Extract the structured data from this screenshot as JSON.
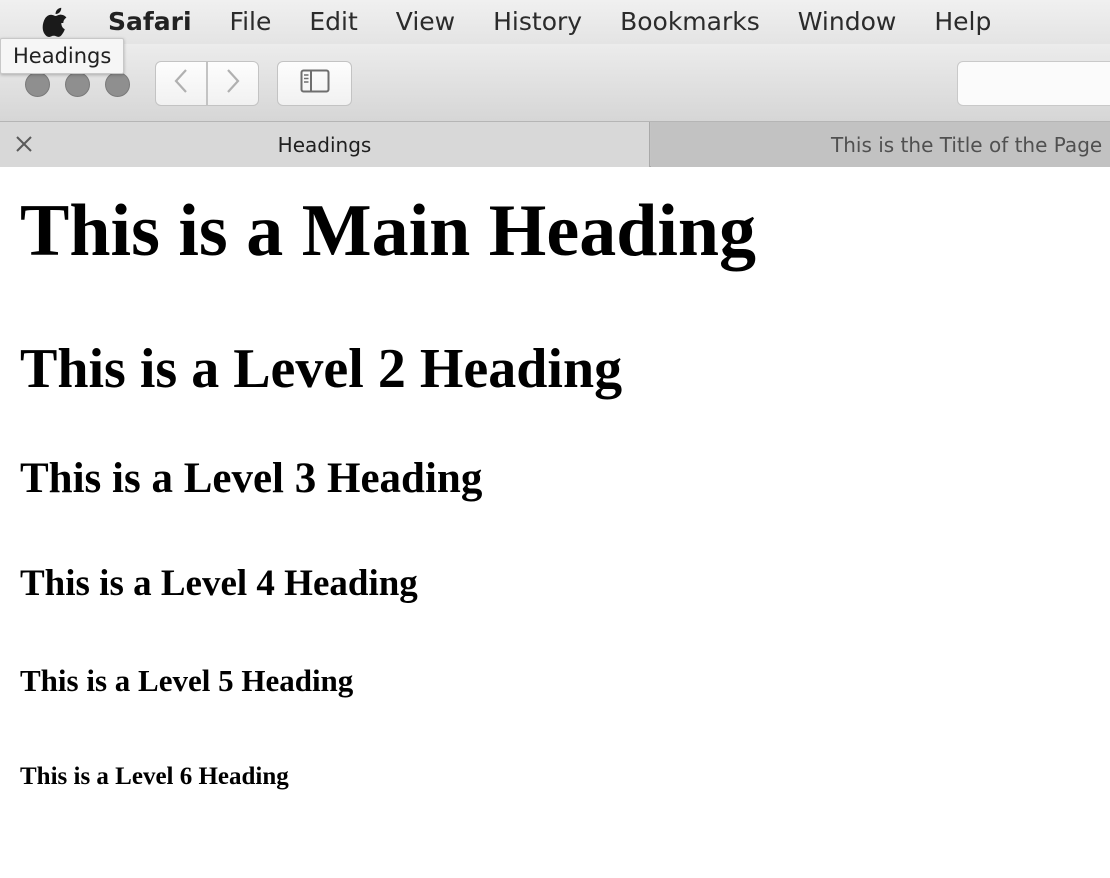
{
  "menubar": {
    "apple_icon": "apple-icon",
    "app_name": "Safari",
    "items": [
      "File",
      "Edit",
      "View",
      "History",
      "Bookmarks",
      "Window",
      "Help"
    ]
  },
  "toolbar": {
    "tooltip": "Headings",
    "back_icon": "chevron-left-icon",
    "forward_icon": "chevron-right-icon",
    "sidebar_icon": "sidebar-icon"
  },
  "tabs": [
    {
      "label": "Headings",
      "active": true
    },
    {
      "label": "This is the Title of the Page",
      "active": false
    }
  ],
  "page": {
    "h1": "This is a Main Heading",
    "h2": "This is a Level 2 Heading",
    "h3": "This is a Level 3 Heading",
    "h4": "This is a Level 4 Heading",
    "h5": "This is a Level 5 Heading",
    "h6": "This is a Level 6 Heading"
  }
}
